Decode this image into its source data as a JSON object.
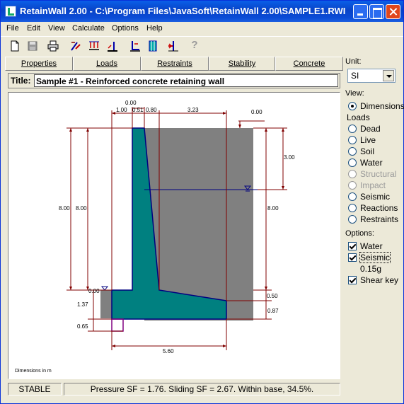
{
  "window": {
    "title": "RetainWall 2.00 - C:\\Program Files\\JavaSoft\\RetainWall 2.00\\SAMPLE1.RWI"
  },
  "menu": [
    "File",
    "Edit",
    "View",
    "Calculate",
    "Options",
    "Help"
  ],
  "toolbar": [
    "new-icon",
    "save-icon",
    "print-icon",
    "properties-icon",
    "loads-icon",
    "restraints-icon",
    "stability-icon",
    "concrete-icon",
    "reinforcement-icon",
    "help-icon"
  ],
  "tabs": [
    "Properties",
    "Loads",
    "Restraints",
    "Stability",
    "Concrete"
  ],
  "title_field": {
    "label": "Title:",
    "value": "Sample #1 - Reinforced concrete retaining wall"
  },
  "side": {
    "unit_label": "Unit:",
    "unit_value": "SI",
    "view_label": "View:",
    "dimensions": "Dimensions",
    "loads_label": "Loads",
    "loads": [
      "Dead",
      "Live",
      "Soil",
      "Water",
      "Structural",
      "Impact",
      "Seismic",
      "Reactions",
      "Restraints"
    ],
    "options_label": "Options:",
    "water": "Water",
    "seismic": "Seismic",
    "seismic_value": "0.15g",
    "shear_key": "Shear key"
  },
  "drawing": {
    "dims": {
      "top_zero": "0.00",
      "d100": "1.00",
      "d051": "0.51",
      "d080": "0.80",
      "d323": "3.23",
      "right_zero": "0.00",
      "d300": "3.00",
      "h800a": "8.00",
      "h800b": "8.00",
      "h800c": "8.00",
      "base_zero": "0.00",
      "d050": "0.50",
      "d137": "1.37",
      "d087": "0.87",
      "d065": "0.65",
      "d560": "5.60"
    },
    "note": "Dimensions in m",
    "colors": {
      "soil": "#808080",
      "concrete": "#008080",
      "outline": "#000080",
      "dim": "#800000",
      "key": "#800080",
      "water": "#000080"
    }
  },
  "status": {
    "state": "STABLE",
    "message": "Pressure SF = 1.76. Sliding SF = 2.67. Within base, 34.5%."
  }
}
